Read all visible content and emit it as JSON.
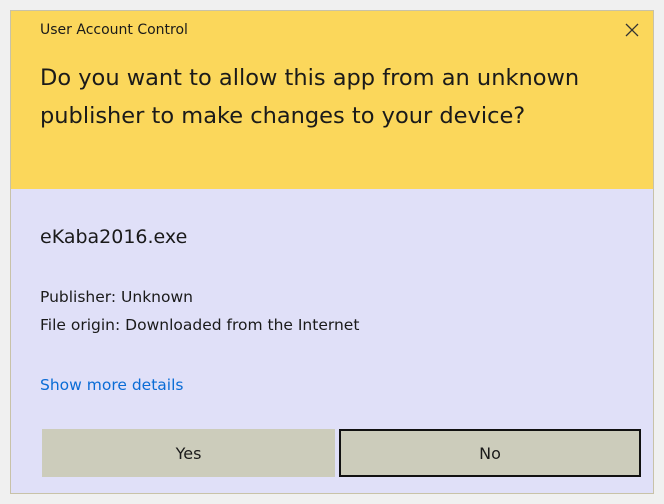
{
  "window": {
    "title": "User Account Control"
  },
  "prompt": {
    "question": "Do you want to allow this app from an unknown publisher to make changes to your device?"
  },
  "app": {
    "name": "eKaba2016.exe",
    "publisher": "Publisher: Unknown",
    "origin": "File origin: Downloaded from the Internet"
  },
  "details_link": "Show more details",
  "buttons": {
    "yes": "Yes",
    "no": "No"
  },
  "colors": {
    "header_bg": "#fbd75b",
    "body_bg": "#e0e0f8",
    "link": "#0a6cd6",
    "button_bg": "#ccccbb"
  },
  "icons": {
    "close": "close-icon"
  }
}
